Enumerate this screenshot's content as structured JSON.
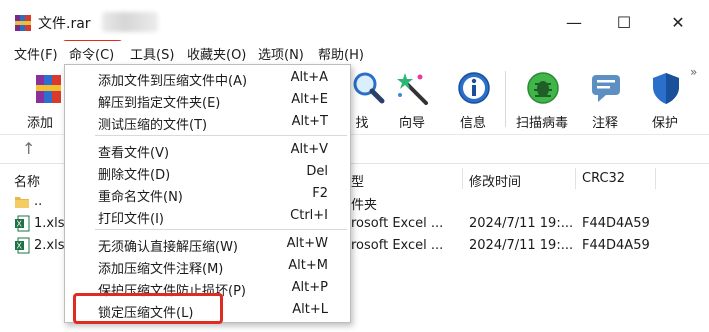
{
  "window": {
    "title": "文件.rar",
    "minimize_glyph": "—",
    "maximize_glyph": "☐",
    "close_glyph": "✕"
  },
  "menubar": {
    "items": [
      {
        "label": "文件(F)"
      },
      {
        "label": "命令(C)"
      },
      {
        "label": "工具(S)"
      },
      {
        "label": "收藏夹(O)"
      },
      {
        "label": "选项(N)"
      },
      {
        "label": "帮助(H)"
      }
    ],
    "active": "命令(C)"
  },
  "toolbar": {
    "items": [
      {
        "label": "添加",
        "icon": "add-books-icon"
      },
      {
        "label": "找",
        "icon": "find-magnifier-icon"
      },
      {
        "label": "向导",
        "icon": "wizard-wand-icon"
      },
      {
        "label": "信息",
        "icon": "info-icon"
      },
      {
        "label": "扫描病毒",
        "icon": "virus-scan-icon"
      },
      {
        "label": "注释",
        "icon": "comment-icon"
      },
      {
        "label": "保护",
        "icon": "shield-icon"
      }
    ],
    "overflow_glyph": "»"
  },
  "address": {
    "up_glyph": "↑"
  },
  "filelist": {
    "columns": [
      "名称",
      "型",
      "修改时间",
      "CRC32"
    ],
    "rows": [
      {
        "name": "..",
        "type": "件夹",
        "modified": "",
        "crc": ""
      },
      {
        "name": "1.xls",
        "type": "rosoft Excel ...",
        "modified": "2024/7/11 19:...",
        "crc": "F44D4A59"
      },
      {
        "name": "2.xls",
        "type": "rosoft Excel ...",
        "modified": "2024/7/11 19:...",
        "crc": "F44D4A59"
      }
    ]
  },
  "command_menu": {
    "items": [
      {
        "label": "添加文件到压缩文件中(A)",
        "shortcut": "Alt+A"
      },
      {
        "label": "解压到指定文件夹(E)",
        "shortcut": "Alt+E"
      },
      {
        "label": "测试压缩的文件(T)",
        "shortcut": "Alt+T"
      },
      {
        "label": "查看文件(V)",
        "shortcut": "Alt+V"
      },
      {
        "label": "删除文件(D)",
        "shortcut": "Del"
      },
      {
        "label": "重命名文件(N)",
        "shortcut": "F2"
      },
      {
        "label": "打印文件(I)",
        "shortcut": "Ctrl+I"
      },
      {
        "label": "无须确认直接解压缩(W)",
        "shortcut": "Alt+W"
      },
      {
        "label": "添加压缩文件注释(M)",
        "shortcut": "Alt+M"
      },
      {
        "label": "保护压缩文件防止损坏(P)",
        "shortcut": "Alt+P"
      },
      {
        "label": "锁定压缩文件(L)",
        "shortcut": "Alt+L"
      }
    ],
    "highlighted": "锁定压缩文件(L)"
  },
  "colors": {
    "annotation_red": "#e02b20",
    "menu_active_bg": "#cce4f7"
  }
}
